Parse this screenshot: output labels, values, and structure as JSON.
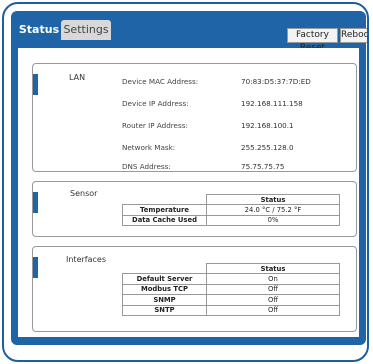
{
  "tabs": [
    "Status",
    "Settings"
  ],
  "buttons": {
    "factory_reset": "Factory Reset",
    "reboot": "Reboot"
  },
  "lan": {
    "title": "LAN",
    "rows": [
      {
        "label": "Device MAC Address:",
        "value": "70:83:D5:37:7D:ED"
      },
      {
        "label": "Device IP Address:",
        "value": "192.168.111.158"
      },
      {
        "label": "Router IP Address:",
        "value": "192.168.100.1"
      },
      {
        "label": "Network Mask:",
        "value": "255.255.128.0"
      },
      {
        "label": "DNS Address:",
        "value": "75.75.75.75"
      }
    ]
  },
  "sensor": {
    "title": "Sensor",
    "header": "Status",
    "rows": [
      {
        "label": "Temperature",
        "value": "24.0 °C / 75.2 °F"
      },
      {
        "label": "Data Cache Used",
        "value": "0%"
      }
    ]
  },
  "interfaces": {
    "title": "Interfaces",
    "header": "Status",
    "rows": [
      {
        "label": "Default Server",
        "value": "On"
      },
      {
        "label": "Modbus TCP",
        "value": "Off"
      },
      {
        "label": "SNMP",
        "value": "Off"
      },
      {
        "label": "SNTP",
        "value": "Off"
      }
    ]
  },
  "colors": {
    "accent": "#1f64a6",
    "border": "#1e5e9e"
  }
}
